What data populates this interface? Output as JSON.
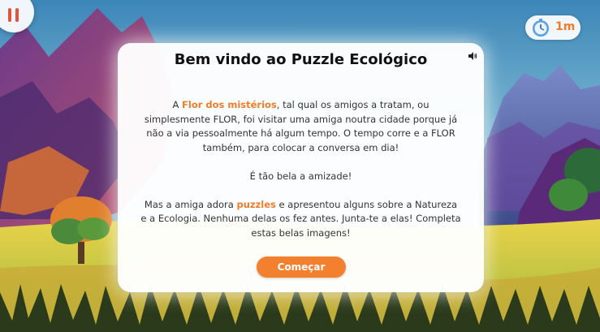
{
  "dialog": {
    "title": "Bem vindo ao Puzzle Ecológico",
    "p1": {
      "before": "A ",
      "highlight": "Flor dos mistérios",
      "after": ", tal qual os amigos a tratam, ou simplesmente FLOR, foi visitar uma amiga noutra cidade porque já não a via pessoalmente há algum tempo. O tempo corre e a FLOR também, para colocar a conversa em dia!"
    },
    "p2": "É tão bela a amizade!",
    "p3": {
      "before": "Mas a amiga adora ",
      "highlight": "puzzles",
      "after": " e apresentou alguns sobre a Natureza e a Ecologia. Nenhuma delas os fez antes. Junta-te a elas! Completa estas belas imagens!"
    },
    "start_label": "Começar"
  },
  "timer": {
    "value": "1m",
    "icon": "stopwatch-icon"
  },
  "icons": {
    "pause": "pause-icon",
    "sound": "speaker-icon"
  },
  "colors": {
    "accent": "#f07c2a",
    "button": "#f2802f",
    "pause": "#e2523d"
  }
}
